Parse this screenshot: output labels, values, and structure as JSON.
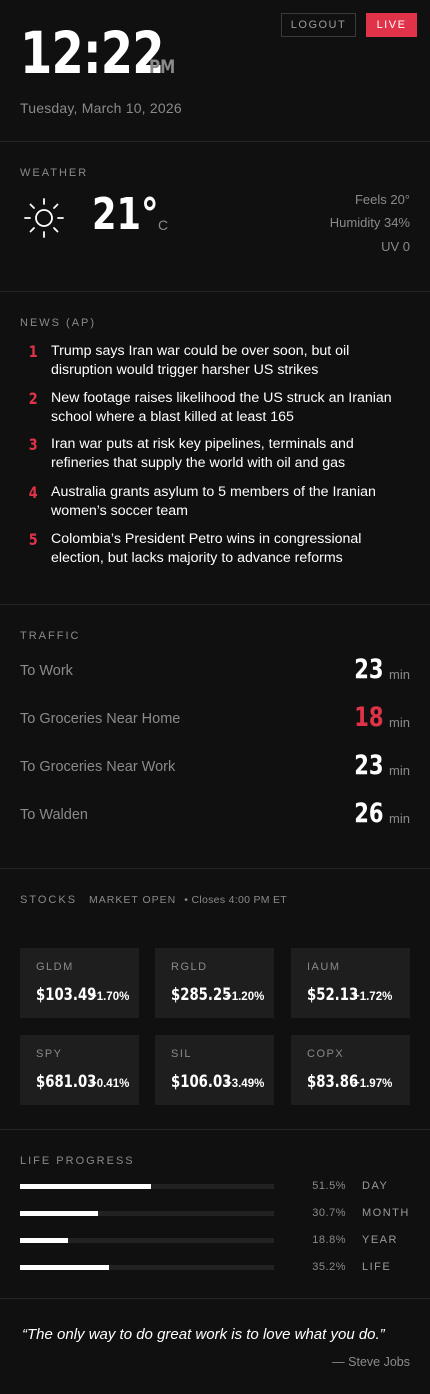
{
  "header": {
    "time": "12:22",
    "ampm": "PM",
    "date": "Tuesday, March 10, 2026",
    "logout_label": "LOGOUT",
    "live_label": "LIVE"
  },
  "weather": {
    "label": "WEATHER",
    "icon": "sun-icon",
    "temperature": "21°",
    "unit": "C",
    "feels": "Feels 20°",
    "humidity": "Humidity 34%",
    "uv": "UV 0"
  },
  "news": {
    "label": "NEWS (AP)",
    "items": [
      {
        "num": "1",
        "text": "Trump says Iran war could be over soon, but oil disruption would trigger harsher US strikes"
      },
      {
        "num": "2",
        "text": "New footage raises likelihood the US struck an Iranian school where a blast killed at least 165"
      },
      {
        "num": "3",
        "text": "Iran war puts at risk key pipelines, terminals and refineries that supply the world with oil and gas"
      },
      {
        "num": "4",
        "text": "Australia grants asylum to 5 members of the Iranian women’s soccer team"
      },
      {
        "num": "5",
        "text": "Colombia’s President Petro wins in congressional election, but lacks majority to advance reforms"
      }
    ]
  },
  "traffic": {
    "label": "TRAFFIC",
    "unit": "min",
    "routes": [
      {
        "name": "To Work",
        "minutes": "23"
      },
      {
        "name": "To Groceries Near Home",
        "minutes": "18"
      },
      {
        "name": "To Groceries Near Work",
        "minutes": "23"
      },
      {
        "name": "To Walden",
        "minutes": "26"
      }
    ]
  },
  "stocks": {
    "label": "STOCKS",
    "market_status": "MARKET OPEN",
    "closes": "• Closes 4:00 PM ET",
    "items": [
      {
        "symbol": "GLDM",
        "price": "$103.49",
        "change": "+1.70%"
      },
      {
        "symbol": "RGLD",
        "price": "$285.25",
        "change": "+1.20%"
      },
      {
        "symbol": "IAUM",
        "price": "$52.13",
        "change": "+1.72%"
      },
      {
        "symbol": "SPY",
        "price": "$681.03",
        "change": "+0.41%"
      },
      {
        "symbol": "SIL",
        "price": "$106.03",
        "change": "+3.49%"
      },
      {
        "symbol": "COPX",
        "price": "$83.86",
        "change": "+1.97%"
      }
    ]
  },
  "life_progress": {
    "label": "LIFE PROGRESS",
    "items": [
      {
        "name": "DAY",
        "percent_label": "51.5%",
        "fraction": 0.515
      },
      {
        "name": "MONTH",
        "percent_label": "30.7%",
        "fraction": 0.307
      },
      {
        "name": "YEAR",
        "percent_label": "18.8%",
        "fraction": 0.188
      },
      {
        "name": "LIFE",
        "percent_label": "35.2%",
        "fraction": 0.352
      }
    ]
  },
  "quote": {
    "text": "“The only way to do great work is to love what you do.”",
    "author": "— Steve Jobs"
  },
  "colors": {
    "background": "#101010",
    "accent_red": "#e0334a",
    "muted_text": "#8a8a8a",
    "card": "#1e1e1e"
  }
}
